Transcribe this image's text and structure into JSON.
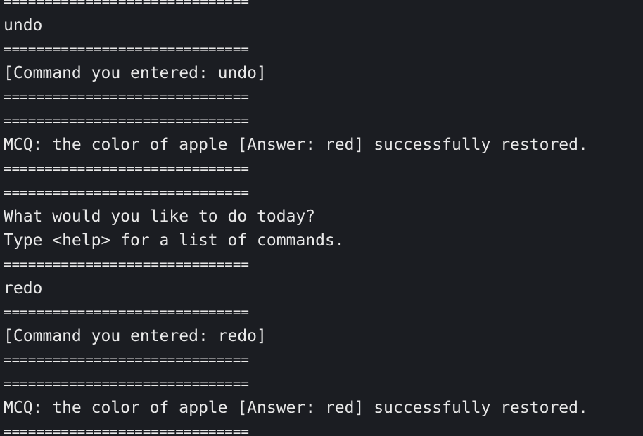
{
  "terminal": {
    "lines": [
      {
        "type": "sep",
        "text": "=============================="
      },
      {
        "type": "text",
        "text": "undo"
      },
      {
        "type": "sep",
        "text": "=============================="
      },
      {
        "type": "text",
        "text": "[Command you entered: undo]"
      },
      {
        "type": "sep",
        "text": "=============================="
      },
      {
        "type": "sep",
        "text": "=============================="
      },
      {
        "type": "text",
        "text": "MCQ: the color of apple [Answer: red] successfully restored."
      },
      {
        "type": "sep",
        "text": "=============================="
      },
      {
        "type": "sep",
        "text": "=============================="
      },
      {
        "type": "text",
        "text": "What would you like to do today?"
      },
      {
        "type": "text",
        "text": "Type <help> for a list of commands."
      },
      {
        "type": "sep",
        "text": "=============================="
      },
      {
        "type": "text",
        "text": "redo"
      },
      {
        "type": "sep",
        "text": "=============================="
      },
      {
        "type": "text",
        "text": "[Command you entered: redo]"
      },
      {
        "type": "sep",
        "text": "=============================="
      },
      {
        "type": "sep",
        "text": "=============================="
      },
      {
        "type": "text",
        "text": "MCQ: the color of apple [Answer: red] successfully restored."
      },
      {
        "type": "sep",
        "text": "=============================="
      }
    ]
  },
  "colors": {
    "background": "#1b1d22",
    "foreground": "#e8e8e8"
  }
}
